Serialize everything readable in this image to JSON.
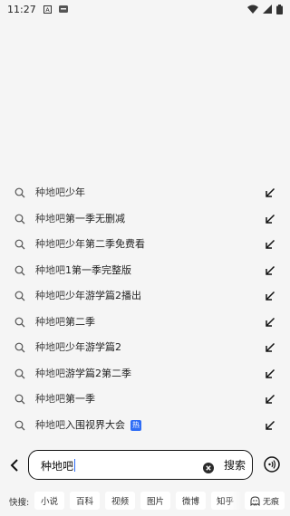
{
  "status_bar": {
    "time": "11:27"
  },
  "suggestions": [
    {
      "prefix": "种地吧",
      "rest": "少年",
      "hot": false
    },
    {
      "prefix": "种地吧",
      "rest": "第一季无删减",
      "hot": false
    },
    {
      "prefix": "种地吧",
      "rest": "少年第二季免费看",
      "hot": false
    },
    {
      "prefix": "种地吧",
      "rest": "1第一季完整版",
      "hot": false
    },
    {
      "prefix": "种地吧",
      "rest": "少年游学篇2播出",
      "hot": false
    },
    {
      "prefix": "种地吧",
      "rest": "第二季",
      "hot": false
    },
    {
      "prefix": "种地吧",
      "rest": "少年游学篇2",
      "hot": false
    },
    {
      "prefix": "种地吧",
      "rest": "游学篇2第二季",
      "hot": false
    },
    {
      "prefix": "种地吧",
      "rest": "第一季",
      "hot": false
    },
    {
      "prefix": "种地吧",
      "rest": "入围视界大会",
      "hot": true,
      "badge": "热"
    }
  ],
  "search": {
    "query": "种地吧",
    "button_label": "搜索"
  },
  "quick_bar": {
    "label": "快搜:",
    "chips": [
      "小说",
      "百科",
      "视频",
      "图片",
      "微博",
      "知乎"
    ],
    "incognito_label": "无痕"
  },
  "colors": {
    "accent": "#2f6df6",
    "background": "#f5f5f5"
  }
}
